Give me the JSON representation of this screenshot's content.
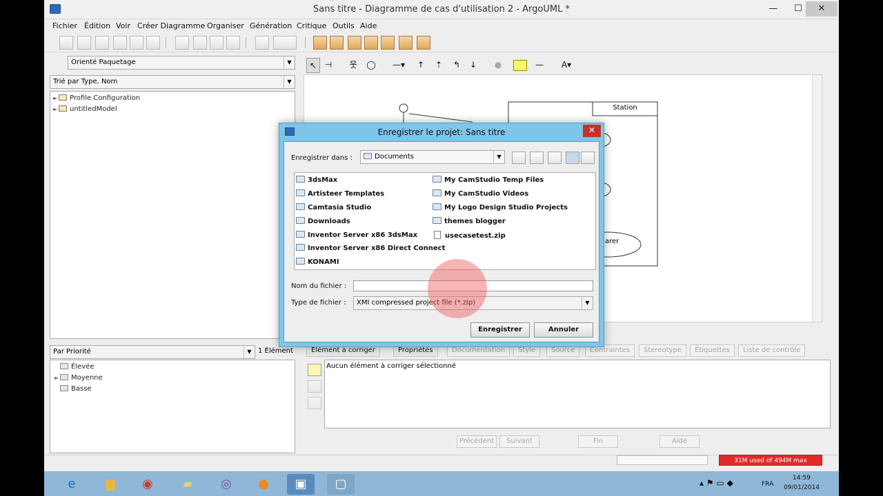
{
  "window": {
    "title": "Sans titre - Diagramme de cas d'utilisation 2 - ArgoUML *",
    "minimize": "—",
    "maximize": "☐",
    "close": "✕"
  },
  "menu": [
    "Fichier",
    "Édition",
    "Voir",
    "Créer Diagramme",
    "Organiser",
    "Génération",
    "Critique",
    "Outils",
    "Aide"
  ],
  "left_panel": {
    "perspective": "Orienté Paquetage",
    "sort": "Trié par Type, Nom",
    "tree": [
      "Profile Configuration",
      "untitledModel"
    ]
  },
  "diagram": {
    "subject_label": "Station",
    "usecase_label": "arer"
  },
  "todo_panel": {
    "group": "Par Priorité",
    "count": "1 Élément",
    "items": [
      "Élevée",
      "Moyenne",
      "Basse"
    ]
  },
  "details": {
    "tabs": [
      "Élément à corriger",
      "Propriétés",
      "Documentation",
      "Style",
      "Source",
      "Contraintes",
      "Stereotype",
      "Étiquettes",
      "Liste de contrôle"
    ],
    "message": "Aucun élément à corriger sélectionné",
    "buttons": [
      "Précédent",
      "Suivant",
      "Fin",
      "Aide"
    ]
  },
  "dialog": {
    "title": "Enregistrer le projet:  Sans titre",
    "save_in_label": "Enregistrer dans :",
    "folder": "Documents",
    "files_left": [
      "3dsMax",
      "Artisteer Templates",
      "Camtasia Studio",
      "Downloads",
      "Inventor Server x86 3dsMax",
      "Inventor Server x86 Direct Connect",
      "KONAMI"
    ],
    "files_right": [
      "My CamStudio Temp Files",
      "My CamStudio Videos",
      "My Logo Design Studio Projects",
      "themes blogger"
    ],
    "zip_file": "usecasetest.zip",
    "filename_label": "Nom du fichier :",
    "filename_value": "",
    "filetype_label": "Type de fichier :",
    "filetype_value": "XMI compressed project file (*.zip)",
    "save_button": "Enregistrer",
    "cancel_button": "Annuler"
  },
  "status": {
    "memory": "31M used of 494M max"
  },
  "taskbar": {
    "lang": "FRA",
    "time": "14:59",
    "date": "09/01/2014"
  }
}
